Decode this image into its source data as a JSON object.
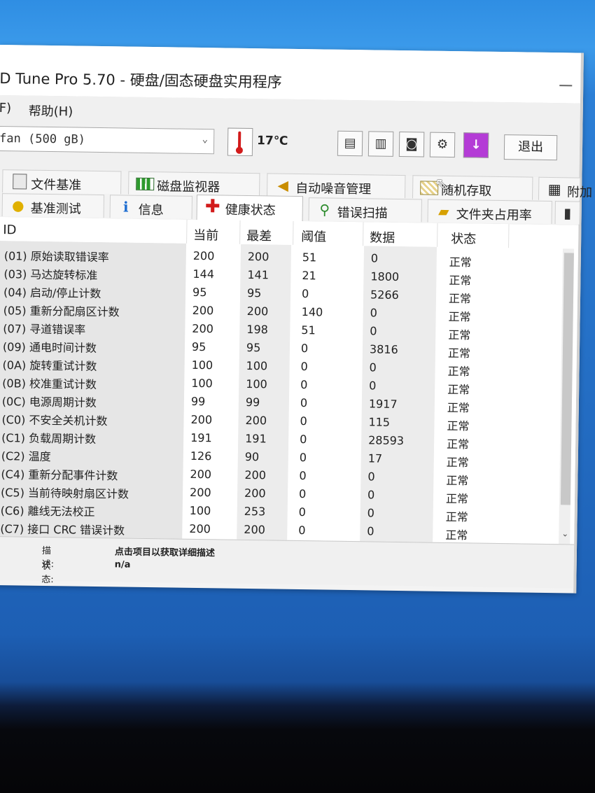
{
  "window": {
    "title": "D Tune Pro 5.70 - 硬盘/固态硬盘实用程序"
  },
  "menu": {
    "file_label": "F)",
    "help_label": "帮助(H)"
  },
  "toolbar": {
    "drive_label": "fan (500 gB)",
    "temperature": "17℃",
    "exit_label": "退出",
    "icons": [
      "copy-info-icon",
      "copy-screenshot-icon",
      "camera-icon",
      "gear-options-icon",
      "download-icon"
    ]
  },
  "tabs_row1": [
    "文件基准",
    "磁盘监视器",
    "自动噪音管理",
    "随机存取",
    "附加"
  ],
  "tabs_row2": [
    "基准测试",
    "信息",
    "健康状态",
    "错误扫描",
    "文件夹占用率"
  ],
  "active_tab": "健康状态",
  "table": {
    "headers": {
      "id": "ID",
      "current": "当前",
      "worst": "最差",
      "threshold": "阈值",
      "data": "数据",
      "status": "状态"
    },
    "rows": [
      {
        "id": "(01) 原始读取错误率",
        "current": "200",
        "worst": "200",
        "threshold": "51",
        "data": "0",
        "status": "正常"
      },
      {
        "id": "(03) 马达旋转标准",
        "current": "144",
        "worst": "141",
        "threshold": "21",
        "data": "1800",
        "status": "正常"
      },
      {
        "id": "(04) 启动/停止计数",
        "current": "95",
        "worst": "95",
        "threshold": "0",
        "data": "5266",
        "status": "正常"
      },
      {
        "id": "(05) 重新分配扇区计数",
        "current": "200",
        "worst": "200",
        "threshold": "140",
        "data": "0",
        "status": "正常"
      },
      {
        "id": "(07) 寻道错误率",
        "current": "200",
        "worst": "198",
        "threshold": "51",
        "data": "0",
        "status": "正常"
      },
      {
        "id": "(09) 通电时间计数",
        "current": "95",
        "worst": "95",
        "threshold": "0",
        "data": "3816",
        "status": "正常"
      },
      {
        "id": "(0A) 旋转重试计数",
        "current": "100",
        "worst": "100",
        "threshold": "0",
        "data": "0",
        "status": "正常"
      },
      {
        "id": "(0B) 校准重试计数",
        "current": "100",
        "worst": "100",
        "threshold": "0",
        "data": "0",
        "status": "正常"
      },
      {
        "id": "(0C) 电源周期计数",
        "current": "99",
        "worst": "99",
        "threshold": "0",
        "data": "1917",
        "status": "正常"
      },
      {
        "id": "(C0) 不安全关机计数",
        "current": "200",
        "worst": "200",
        "threshold": "0",
        "data": "115",
        "status": "正常"
      },
      {
        "id": "(C1) 负载周期计数",
        "current": "191",
        "worst": "191",
        "threshold": "0",
        "data": "28593",
        "status": "正常"
      },
      {
        "id": "(C2) 温度",
        "current": "126",
        "worst": "90",
        "threshold": "0",
        "data": "17",
        "status": "正常"
      },
      {
        "id": "(C4) 重新分配事件计数",
        "current": "200",
        "worst": "200",
        "threshold": "0",
        "data": "0",
        "status": "正常"
      },
      {
        "id": "(C5) 当前待映射扇区计数",
        "current": "200",
        "worst": "200",
        "threshold": "0",
        "data": "0",
        "status": "正常"
      },
      {
        "id": "(C6) 離线无法校正",
        "current": "100",
        "worst": "253",
        "threshold": "0",
        "data": "0",
        "status": "正常"
      },
      {
        "id": "(C7) 接口 CRC 错误计数",
        "current": "200",
        "worst": "200",
        "threshold": "0",
        "data": "0",
        "status": "正常"
      }
    ]
  },
  "details": {
    "description_label": "描述:",
    "description_value": "点击项目以获取详细描述",
    "status_label": "状态:",
    "status_value": "n/a"
  }
}
